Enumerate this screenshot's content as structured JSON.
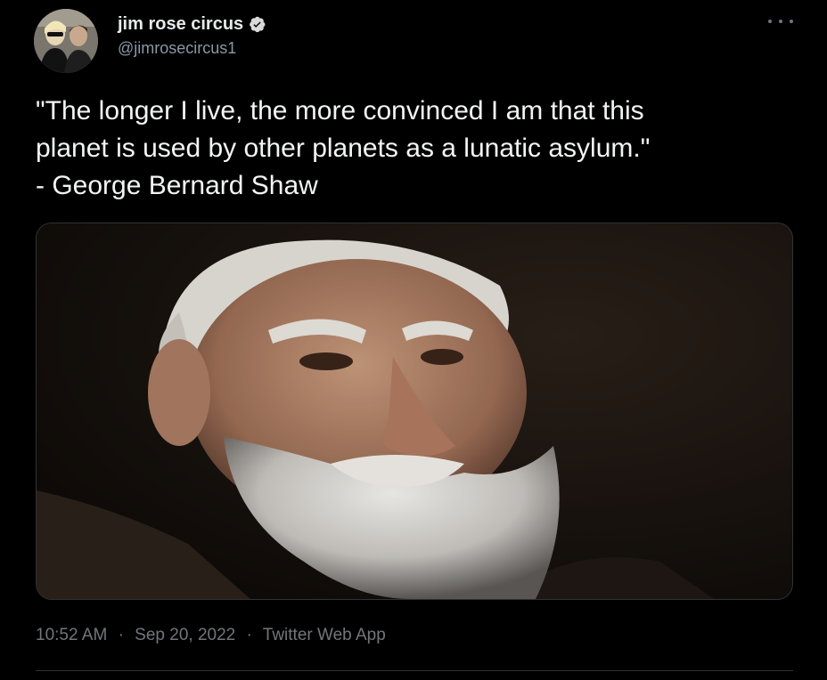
{
  "author": {
    "display_name": "jim rose circus",
    "handle": "@jimrosecircus1",
    "verified": true
  },
  "tweet": {
    "text_lines": [
      "\"The longer I live, the more convinced I am that this",
      "planet is used by other planets as a lunatic asylum.\"",
      "- George Bernard Shaw"
    ]
  },
  "meta": {
    "time": "10:52 AM",
    "date": "Sep 20, 2022",
    "source": "Twitter Web App",
    "separator": "·"
  },
  "icons": {
    "verified": "verified-badge-icon",
    "more": "more-horizontal-icon"
  },
  "colors": {
    "background": "#000000",
    "text": "#e7e9ea",
    "secondary": "#71767b",
    "verified": "#d9d9d9"
  }
}
